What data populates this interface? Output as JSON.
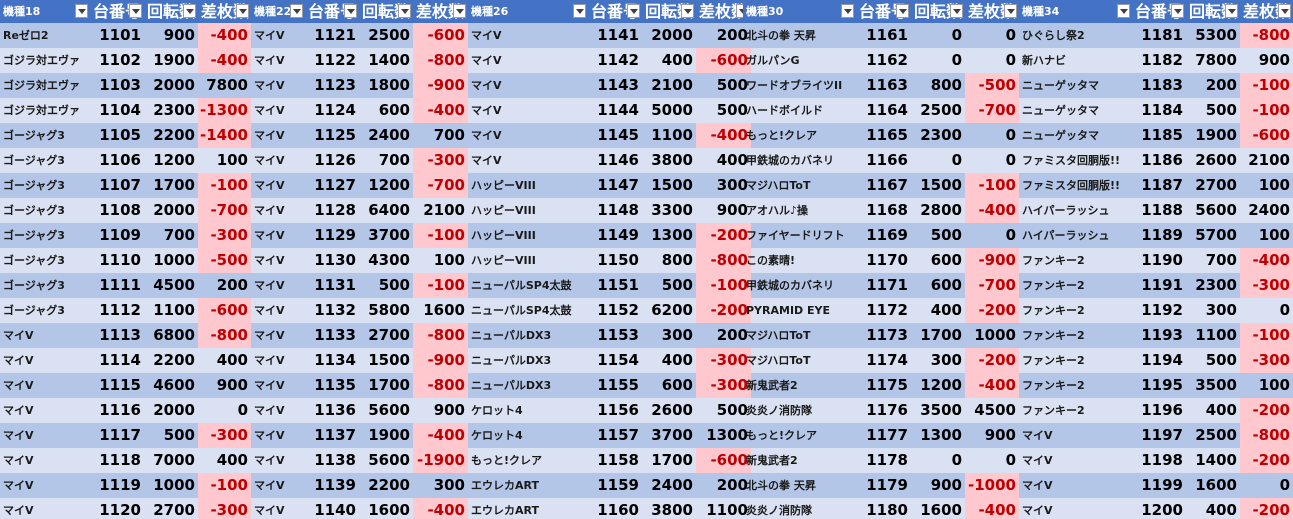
{
  "headers": {
    "groups": [
      {
        "model": "機種18",
        "number": "台番号",
        "spins": "回転数",
        "diff": "差枚数"
      },
      {
        "model": "機種22",
        "number": "台番号",
        "spins": "回転数",
        "diff": "差枚数"
      },
      {
        "model": "機種26",
        "number": "台番号",
        "spins": "回転数",
        "diff": "差枚数"
      },
      {
        "model": "機種30",
        "number": "台番号",
        "spins": "回転数",
        "diff": "差枚数"
      },
      {
        "model": "機種34",
        "number": "台番号",
        "spins": "回転数",
        "diff": "差枚数"
      }
    ]
  },
  "rows": [
    [
      [
        "Reゼロ2",
        "1101",
        "900",
        "-400"
      ],
      [
        "マイV",
        "1121",
        "2500",
        "-600"
      ],
      [
        "マイV",
        "1141",
        "2000",
        "200"
      ],
      [
        "北斗の拳 天昇",
        "1161",
        "0",
        "0"
      ],
      [
        "ひぐらし祭2",
        "1181",
        "5300",
        "-800"
      ]
    ],
    [
      [
        "ゴジラ対エヴァ",
        "1102",
        "1900",
        "-400"
      ],
      [
        "マイV",
        "1122",
        "1400",
        "-800"
      ],
      [
        "マイV",
        "1142",
        "400",
        "-600"
      ],
      [
        "ガルパンG",
        "1162",
        "0",
        "0"
      ],
      [
        "新ハナビ",
        "1182",
        "7800",
        "900"
      ]
    ],
    [
      [
        "ゴジラ対エヴァ",
        "1103",
        "2000",
        "7800"
      ],
      [
        "マイV",
        "1123",
        "1800",
        "-900"
      ],
      [
        "マイV",
        "1143",
        "2100",
        "500"
      ],
      [
        "ワードオブライツII",
        "1163",
        "800",
        "-500"
      ],
      [
        "ニューゲッタマ",
        "1183",
        "200",
        "-100"
      ]
    ],
    [
      [
        "ゴジラ対エヴァ",
        "1104",
        "2300",
        "-1300"
      ],
      [
        "マイV",
        "1124",
        "600",
        "-400"
      ],
      [
        "マイV",
        "1144",
        "5000",
        "500"
      ],
      [
        "ハードボイルド",
        "1164",
        "2500",
        "-700"
      ],
      [
        "ニューゲッタマ",
        "1184",
        "500",
        "-100"
      ]
    ],
    [
      [
        "ゴージャグ3",
        "1105",
        "2200",
        "-1400"
      ],
      [
        "マイV",
        "1125",
        "2400",
        "700"
      ],
      [
        "マイV",
        "1145",
        "1100",
        "-400"
      ],
      [
        "もっと!クレア",
        "1165",
        "2300",
        "0"
      ],
      [
        "ニューゲッタマ",
        "1185",
        "1900",
        "-600"
      ]
    ],
    [
      [
        "ゴージャグ3",
        "1106",
        "1200",
        "100"
      ],
      [
        "マイV",
        "1126",
        "700",
        "-300"
      ],
      [
        "マイV",
        "1146",
        "3800",
        "400"
      ],
      [
        "甲鉄城のカバネリ",
        "1166",
        "0",
        "0"
      ],
      [
        "ファミスタ回胴版!!",
        "1186",
        "2600",
        "2100"
      ]
    ],
    [
      [
        "ゴージャグ3",
        "1107",
        "1700",
        "-100"
      ],
      [
        "マイV",
        "1127",
        "1200",
        "-700"
      ],
      [
        "ハッピーVIII",
        "1147",
        "1500",
        "300"
      ],
      [
        "マジハロToT",
        "1167",
        "1500",
        "-100"
      ],
      [
        "ファミスタ回胴版!!",
        "1187",
        "2700",
        "100"
      ]
    ],
    [
      [
        "ゴージャグ3",
        "1108",
        "2000",
        "-700"
      ],
      [
        "マイV",
        "1128",
        "6400",
        "2100"
      ],
      [
        "ハッピーVIII",
        "1148",
        "3300",
        "900"
      ],
      [
        "アオハル♪操",
        "1168",
        "2800",
        "-400"
      ],
      [
        "ハイパーラッシュ",
        "1188",
        "5600",
        "2400"
      ]
    ],
    [
      [
        "ゴージャグ3",
        "1109",
        "700",
        "-300"
      ],
      [
        "マイV",
        "1129",
        "3700",
        "-100"
      ],
      [
        "ハッピーVIII",
        "1149",
        "1300",
        "-200"
      ],
      [
        "ファイヤードリフト",
        "1169",
        "500",
        "0"
      ],
      [
        "ハイパーラッシュ",
        "1189",
        "5700",
        "100"
      ]
    ],
    [
      [
        "ゴージャグ3",
        "1110",
        "1000",
        "-500"
      ],
      [
        "マイV",
        "1130",
        "4300",
        "100"
      ],
      [
        "ハッピーVIII",
        "1150",
        "800",
        "-800"
      ],
      [
        "この素晴!",
        "1170",
        "600",
        "-900"
      ],
      [
        "ファンキー2",
        "1190",
        "700",
        "-400"
      ]
    ],
    [
      [
        "ゴージャグ3",
        "1111",
        "4500",
        "200"
      ],
      [
        "マイV",
        "1131",
        "500",
        "-100"
      ],
      [
        "ニューパルSP4太鼓",
        "1151",
        "500",
        "-100"
      ],
      [
        "甲鉄城のカバネリ",
        "1171",
        "600",
        "-700"
      ],
      [
        "ファンキー2",
        "1191",
        "2300",
        "-300"
      ]
    ],
    [
      [
        "ゴージャグ3",
        "1112",
        "1100",
        "-600"
      ],
      [
        "マイV",
        "1132",
        "5800",
        "1600"
      ],
      [
        "ニューパルSP4太鼓",
        "1152",
        "6200",
        "-200"
      ],
      [
        "PYRAMID EYE",
        "1172",
        "400",
        "-200"
      ],
      [
        "ファンキー2",
        "1192",
        "300",
        "0"
      ]
    ],
    [
      [
        "マイV",
        "1113",
        "6800",
        "-800"
      ],
      [
        "マイV",
        "1133",
        "2700",
        "-800"
      ],
      [
        "ニューパルDX3",
        "1153",
        "300",
        "200"
      ],
      [
        "マジハロToT",
        "1173",
        "1700",
        "1000"
      ],
      [
        "ファンキー2",
        "1193",
        "1100",
        "-100"
      ]
    ],
    [
      [
        "マイV",
        "1114",
        "2200",
        "400"
      ],
      [
        "マイV",
        "1134",
        "1500",
        "-900"
      ],
      [
        "ニューパルDX3",
        "1154",
        "400",
        "-300"
      ],
      [
        "マジハロToT",
        "1174",
        "300",
        "-200"
      ],
      [
        "ファンキー2",
        "1194",
        "500",
        "-300"
      ]
    ],
    [
      [
        "マイV",
        "1115",
        "4600",
        "900"
      ],
      [
        "マイV",
        "1135",
        "1700",
        "-800"
      ],
      [
        "ニューパルDX3",
        "1155",
        "600",
        "-300"
      ],
      [
        "新鬼武者2",
        "1175",
        "1200",
        "-400"
      ],
      [
        "ファンキー2",
        "1195",
        "3500",
        "100"
      ]
    ],
    [
      [
        "マイV",
        "1116",
        "2000",
        "0"
      ],
      [
        "マイV",
        "1136",
        "5600",
        "900"
      ],
      [
        "ケロット4",
        "1156",
        "2600",
        "500"
      ],
      [
        "炎炎ノ消防隊",
        "1176",
        "3500",
        "4500"
      ],
      [
        "ファンキー2",
        "1196",
        "400",
        "-200"
      ]
    ],
    [
      [
        "マイV",
        "1117",
        "500",
        "-300"
      ],
      [
        "マイV",
        "1137",
        "1900",
        "-400"
      ],
      [
        "ケロット4",
        "1157",
        "3700",
        "1300"
      ],
      [
        "もっと!クレア",
        "1177",
        "1300",
        "900"
      ],
      [
        "マイV",
        "1197",
        "2500",
        "-800"
      ]
    ],
    [
      [
        "マイV",
        "1118",
        "7000",
        "400"
      ],
      [
        "マイV",
        "1138",
        "5600",
        "-1900"
      ],
      [
        "もっと!クレア",
        "1158",
        "1700",
        "-600"
      ],
      [
        "新鬼武者2",
        "1178",
        "0",
        "0"
      ],
      [
        "マイV",
        "1198",
        "1400",
        "-200"
      ]
    ],
    [
      [
        "マイV",
        "1119",
        "1000",
        "-100"
      ],
      [
        "マイV",
        "1139",
        "2200",
        "300"
      ],
      [
        "エウレカART",
        "1159",
        "2400",
        "200"
      ],
      [
        "北斗の拳 天昇",
        "1179",
        "900",
        "-1000"
      ],
      [
        "マイV",
        "1199",
        "1600",
        "0"
      ]
    ],
    [
      [
        "マイV",
        "1120",
        "2700",
        "-300"
      ],
      [
        "マイV",
        "1140",
        "1600",
        "-400"
      ],
      [
        "エウレカART",
        "1160",
        "3800",
        "1100"
      ],
      [
        "炎炎ノ消防隊",
        "1180",
        "1600",
        "-400"
      ],
      [
        "マイV",
        "1200",
        "400",
        "-200"
      ]
    ]
  ],
  "colors": {
    "header_bg": "#4472c4",
    "row_odd": "#b4c6e7",
    "row_even": "#d9e1f2",
    "negative_bg": "#ffc7ce",
    "negative_text": "#c00000"
  }
}
